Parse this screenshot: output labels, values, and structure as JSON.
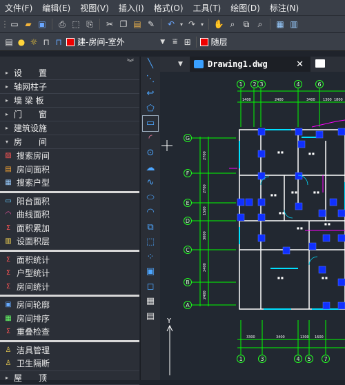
{
  "menu": [
    "文件(F)",
    "编辑(E)",
    "视图(V)",
    "插入(I)",
    "格式(O)",
    "工具(T)",
    "绘图(D)",
    "标注(N)"
  ],
  "layer": {
    "name": "建-房间-室外",
    "color": "#e00000"
  },
  "linetype": {
    "label": "随层"
  },
  "sidebar": {
    "categories_top": [
      "设　　置",
      "轴网柱子",
      "墙 梁 板",
      "门　　窗",
      "建筑设施"
    ],
    "room_category": "房　　间",
    "group1": [
      "搜索房间",
      "房间面积",
      "搜索户型"
    ],
    "group2": [
      "阳台面积",
      "曲线面积",
      "面积累加",
      "设面积层"
    ],
    "group3": [
      "面积统计",
      "户型统计",
      "房间统计"
    ],
    "group4": [
      "房间轮廓",
      "房间排序",
      "重叠检查"
    ],
    "group5": [
      "洁具管理",
      "卫生隔断"
    ],
    "bottom_category": "屋　　顶"
  },
  "tab": {
    "filename": "Drawing1.dwg"
  },
  "drawing": {
    "top_axes": [
      "1",
      "2",
      "3",
      "4",
      "6"
    ],
    "bottom_axes": [
      "1",
      "3",
      "4",
      "5",
      "7"
    ],
    "left_axes": [
      "G",
      "F",
      "E",
      "D",
      "C",
      "B",
      "A"
    ],
    "top_dims": [
      "1400",
      "2400",
      "3400",
      "1300",
      "1800"
    ],
    "bottom_dims": [
      "3300",
      "3400",
      "1300",
      "1600"
    ],
    "left_dims": [
      "2700",
      "2700",
      "1500",
      "3000",
      "2400",
      "2400"
    ],
    "crosshair_y_label": "Y"
  },
  "colors": {
    "accent": "#4da6ff",
    "axis": "#22ff22",
    "wall": "#ffffff",
    "window": "#00e0ff",
    "column": "#1030ff",
    "dim": "#00ff00",
    "magenta": "#ff00ff"
  }
}
